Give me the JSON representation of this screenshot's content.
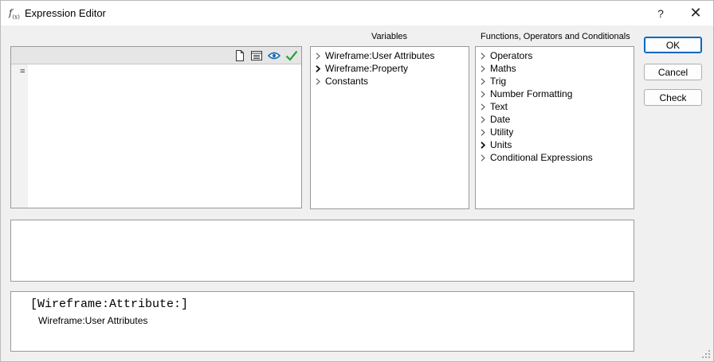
{
  "window": {
    "title": "Expression Editor",
    "icon_main": "f",
    "icon_sub": "(x)",
    "help_label": "?",
    "close_label": "✕"
  },
  "editor": {
    "content": "=",
    "toolbar": [
      {
        "name": "new-document-icon"
      },
      {
        "name": "list-view-icon"
      },
      {
        "name": "eye-icon"
      },
      {
        "name": "checkmark-icon"
      }
    ]
  },
  "variables": {
    "label": "Variables",
    "items": [
      {
        "label": "Wireframe:User Attributes",
        "icon": "chevron-right-icon"
      },
      {
        "label": "Wireframe:Property",
        "icon": "chevron-right-bold-icon"
      },
      {
        "label": "Constants",
        "icon": "chevron-right-icon"
      }
    ]
  },
  "functions": {
    "label": "Functions, Operators and Conditionals",
    "items": [
      {
        "label": "Operators",
        "icon": "chevron-right-icon"
      },
      {
        "label": "Maths",
        "icon": "chevron-right-icon"
      },
      {
        "label": "Trig",
        "icon": "chevron-right-icon"
      },
      {
        "label": "Number Formatting",
        "icon": "chevron-right-icon"
      },
      {
        "label": "Text",
        "icon": "chevron-right-icon"
      },
      {
        "label": "Date",
        "icon": "chevron-right-icon"
      },
      {
        "label": "Utility",
        "icon": "chevron-right-icon"
      },
      {
        "label": "Units",
        "icon": "chevron-right-bold-icon"
      },
      {
        "label": "Conditional Expressions",
        "icon": "chevron-right-icon"
      }
    ]
  },
  "buttons": {
    "ok": "OK",
    "cancel": "Cancel",
    "check": "Check"
  },
  "help": {
    "signature": "[Wireframe:Attribute:]",
    "description": "Wireframe:User Attributes"
  },
  "colors": {
    "accent": "#0067c0",
    "eye_icon": "#1f6fb5",
    "check_icon": "#2e9e3a"
  }
}
